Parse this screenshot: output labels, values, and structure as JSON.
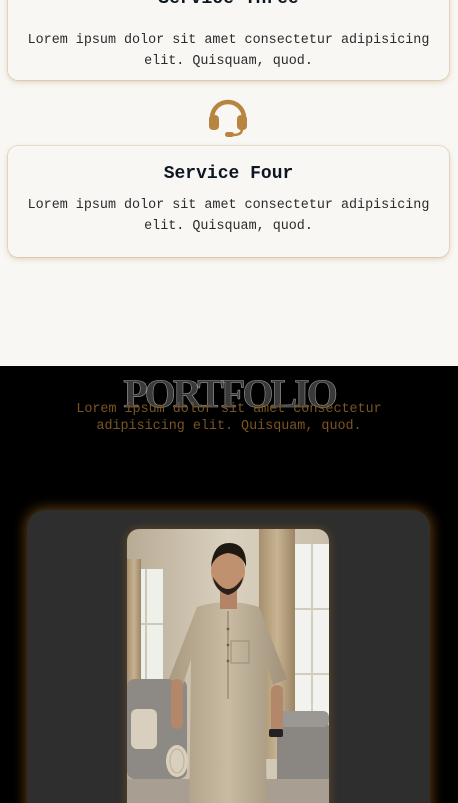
{
  "services": {
    "cards": [
      {
        "title": "Service Three",
        "text": "Lorem ipsum dolor sit amet consectetur adipisicing elit. Quisquam, quod."
      },
      {
        "title": "Service Four",
        "text": "Lorem ipsum dolor sit amet consectetur adipisicing elit. Quisquam, quod."
      }
    ],
    "icon": "headset-icon",
    "accent_color": "#b7853f"
  },
  "portfolio": {
    "title": "PORTFOLIO",
    "subtitle": "Lorem ipsum dolor sit amet consectetur adipisicing elit. Quisquam, quod.",
    "subtitle_color": "#7a5522",
    "glow_color": "#c97e20"
  }
}
